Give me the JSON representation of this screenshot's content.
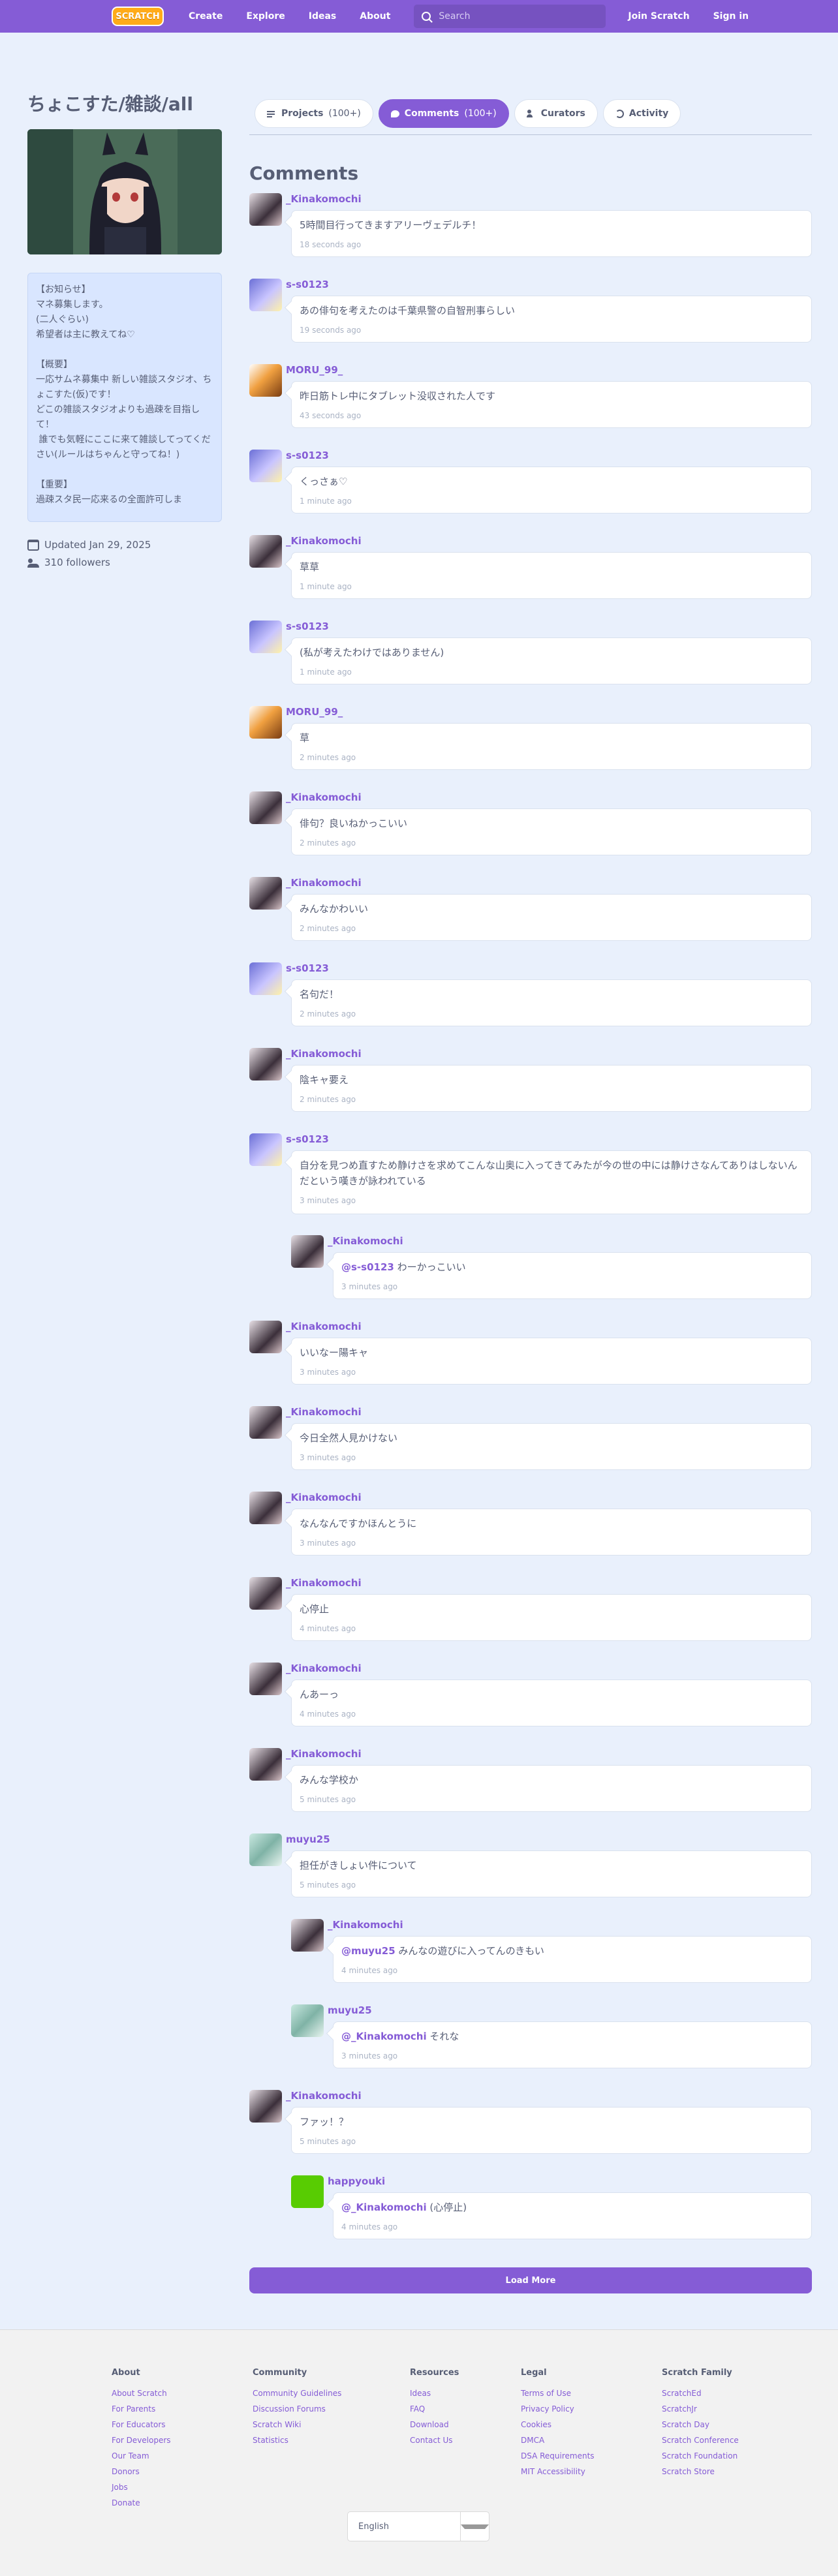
{
  "nav": {
    "logo": "SCRATCH",
    "links": [
      "Create",
      "Explore",
      "Ideas",
      "About"
    ],
    "search_placeholder": "Search",
    "join": "Join Scratch",
    "signin": "Sign in"
  },
  "studio": {
    "title": "ちょこすた/雑談/all",
    "description": "【お知らせ】\nマネ募集します。\n(二人ぐらい)\n希望者は主に教えてね♡\n\n【概要】\n一応サムネ募集中 新しい雑談スタジオ、ちょこすた(仮)です！\nどこの雑談スタジオよりも過疎を目指して！\n 誰でも気軽にここに来て雑談してってください(ルールはちゃんと守ってね！)\n\n【重要】\n過疎スタ民一応来るの全面許可しま",
    "updated": "Updated Jan 29, 2025",
    "followers": "310 followers"
  },
  "tabs": [
    {
      "label": "Projects",
      "count": "(100+)",
      "icon": "projects-icon"
    },
    {
      "label": "Comments",
      "count": "(100+)",
      "icon": "comments-icon"
    },
    {
      "label": "Curators",
      "count": "",
      "icon": "curators-icon"
    },
    {
      "label": "Activity",
      "count": "",
      "icon": "activity-icon"
    }
  ],
  "comments_title": "Comments",
  "comments": [
    {
      "user": "_Kinakomochi",
      "text": "5時間目行ってきますアリーヴェデルチ！",
      "time": "18 seconds ago"
    },
    {
      "user": "s-s0123",
      "text": "あの俳句を考えたのは千葉県警の自智刑事らしい",
      "time": "19 seconds ago"
    },
    {
      "user": "MORU_99_",
      "text": "昨日筋トレ中にタブレット没収された人です",
      "time": "43 seconds ago"
    },
    {
      "user": "s-s0123",
      "text": "くっさぁ♡",
      "time": "1 minute ago"
    },
    {
      "user": "_Kinakomochi",
      "text": "草草",
      "time": "1 minute ago"
    },
    {
      "user": "s-s0123",
      "text": "(私が考えたわけではありません)",
      "time": "1 minute ago"
    },
    {
      "user": "MORU_99_",
      "text": "草",
      "time": "2 minutes ago"
    },
    {
      "user": "_Kinakomochi",
      "text": "俳句？良いねかっこいい",
      "time": "2 minutes ago"
    },
    {
      "user": "_Kinakomochi",
      "text": "みんなかわいい",
      "time": "2 minutes ago"
    },
    {
      "user": "s-s0123",
      "text": "名句だ！",
      "time": "2 minutes ago"
    },
    {
      "user": "_Kinakomochi",
      "text": "陰キャ要え",
      "time": "2 minutes ago"
    },
    {
      "user": "s-s0123",
      "text": "自分を見つめ直すため静けさを求めてこんな山奥に入ってきてみたが今の世の中には静けさなんてありはしないんだという嘆きが詠われている",
      "time": "3 minutes ago"
    },
    {
      "user": "_Kinakomochi",
      "mention": "@s-s0123",
      "text": " わーかっこいい",
      "time": "3 minutes ago"
    },
    {
      "user": "_Kinakomochi",
      "text": "いいなー陽キャ",
      "time": "3 minutes ago"
    },
    {
      "user": "_Kinakomochi",
      "text": "今日全然人見かけない",
      "time": "3 minutes ago"
    },
    {
      "user": "_Kinakomochi",
      "text": "なんなんですかほんとうに",
      "time": "3 minutes ago"
    },
    {
      "user": "_Kinakomochi",
      "text": "心停止",
      "time": "4 minutes ago"
    },
    {
      "user": "_Kinakomochi",
      "text": "んあーっ",
      "time": "4 minutes ago"
    },
    {
      "user": "_Kinakomochi",
      "text": "みんな学校か",
      "time": "5 minutes ago"
    },
    {
      "user": "muyu25",
      "text": "担任がきしょい件について",
      "time": "5 minutes ago"
    },
    {
      "user": "_Kinakomochi",
      "mention": "@muyu25",
      "text": " みんなの遊びに入ってんのきもい",
      "time": "4 minutes ago"
    },
    {
      "user": "muyu25",
      "mention": "@_Kinakomochi",
      "text": " それな",
      "time": "3 minutes ago"
    },
    {
      "user": "_Kinakomochi",
      "text": "ファッ！？",
      "time": "5 minutes ago"
    },
    {
      "user": "happyouki",
      "mention": "@_Kinakomochi",
      "text": " (心停止)",
      "time": "4 minutes ago"
    }
  ],
  "load_more": "Load More",
  "footer": {
    "columns": [
      {
        "title": "About",
        "links": [
          "About Scratch",
          "For Parents",
          "For Educators",
          "For Developers",
          "Our Team",
          "Donors",
          "Jobs",
          "Donate"
        ]
      },
      {
        "title": "Community",
        "links": [
          "Community Guidelines",
          "Discussion Forums",
          "Scratch Wiki",
          "Statistics"
        ]
      },
      {
        "title": "Resources",
        "links": [
          "Ideas",
          "FAQ",
          "Download",
          "Contact Us"
        ]
      },
      {
        "title": "Legal",
        "links": [
          "Terms of Use",
          "Privacy Policy",
          "Cookies",
          "DMCA",
          "DSA Requirements",
          "MIT Accessibility"
        ]
      },
      {
        "title": "Scratch Family",
        "links": [
          "ScratchEd",
          "ScratchJr",
          "Scratch Day",
          "Scratch Conference",
          "Scratch Foundation",
          "Scratch Store"
        ]
      }
    ],
    "language": "English"
  },
  "colors": {
    "brand": "#855cd6",
    "background": "#e9f0fc",
    "text": "#575e75"
  }
}
